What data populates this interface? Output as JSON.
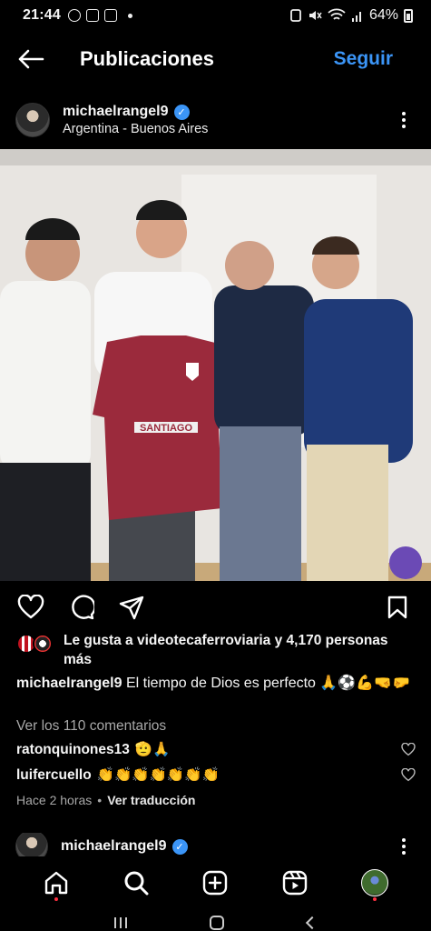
{
  "status_bar": {
    "time": "21:44",
    "battery": "64%",
    "icons": [
      "whatsapp-icon",
      "instagram-icon",
      "gallery-icon",
      "alarm-icon",
      "mute-icon",
      "wifi-icon",
      "signal-icon",
      "battery-icon"
    ]
  },
  "topbar": {
    "title": "Publicaciones",
    "follow_label": "Seguir"
  },
  "post": {
    "username": "michaelrangel9",
    "location": "Argentina - Buenos Aires",
    "jersey_text": "SANTIAGO",
    "likes_text": "Le gusta a videotecaferroviaria y 4,170 personas más",
    "caption_user": "michaelrangel9",
    "caption_text": "El tiempo de Dios es perfecto 🙏⚽💪🤜🤛",
    "view_comments": "Ver los 110 comentarios",
    "comments": [
      {
        "user": "ratonquinones13",
        "text": "🫡🙏"
      },
      {
        "user": "luifercuello",
        "text": "👏👏👏👏👏👏👏"
      }
    ],
    "time_ago": "Hace 2 horas",
    "translate_label": "Ver traducción"
  },
  "next_post": {
    "username": "michaelrangel9"
  },
  "colors": {
    "accent_blue": "#3b95f7",
    "notification_red": "#ff3040",
    "jersey": "#9b2a3c"
  }
}
